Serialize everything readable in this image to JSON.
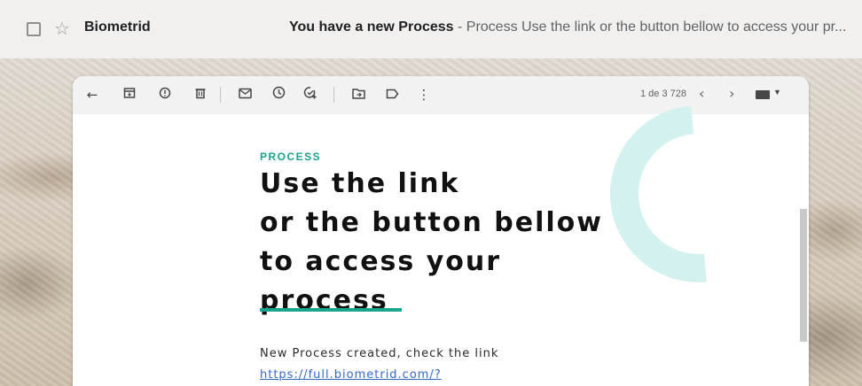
{
  "inbox_row": {
    "sender": "Biometrid",
    "subject": "You have a new Process",
    "snippet": " - Process Use the link or the button bellow to access your pr..."
  },
  "toolbar": {
    "icons": [
      "back-arrow-icon",
      "archive-icon",
      "report-spam-icon",
      "delete-icon",
      "mark-unread-icon",
      "snooze-icon",
      "add-task-icon",
      "move-to-icon",
      "label-icon",
      "more-vert-icon"
    ],
    "pager": "1 de 3 728",
    "prev": "‹",
    "next": "›"
  },
  "email": {
    "eyebrow": "PROCESS",
    "headline_lines": [
      "Use the link",
      "or the button bellow",
      "to access your",
      "process"
    ],
    "notice": "New Process created, check the link",
    "link": "https://full.biometrid.com/?"
  },
  "colors": {
    "accent": "#19a48d",
    "link": "#3568c6",
    "deco": "#d3f1ee"
  }
}
